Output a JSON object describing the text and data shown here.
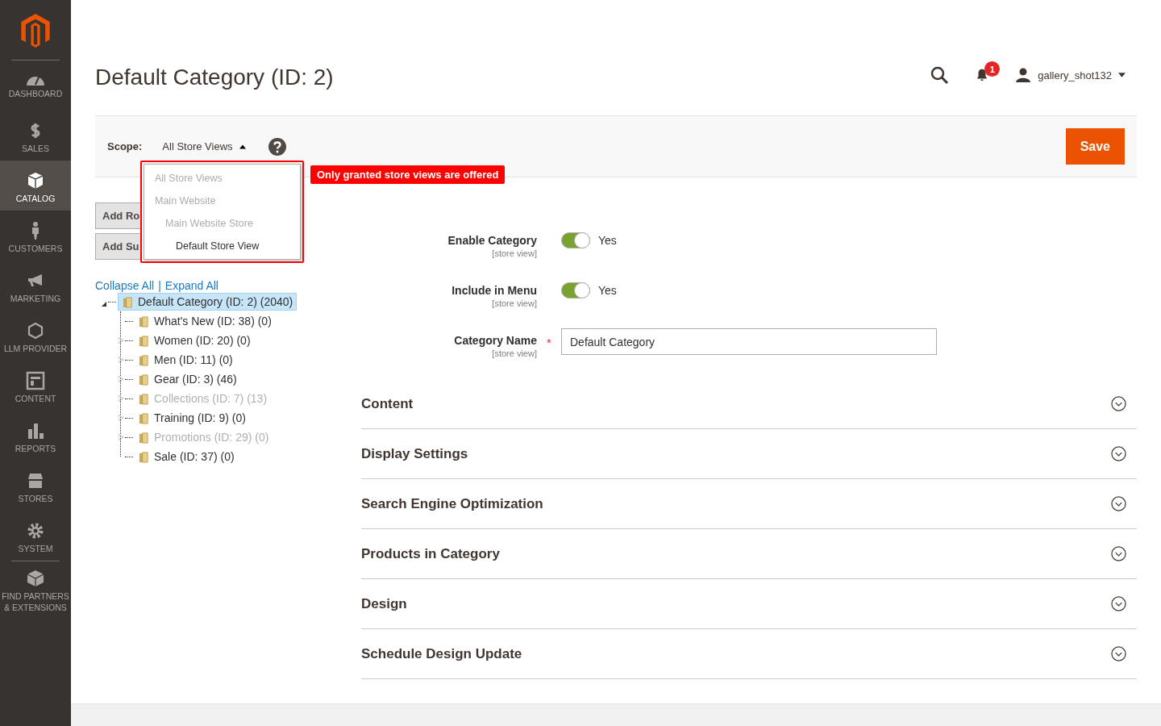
{
  "sidebar": {
    "items": [
      {
        "label": "DASHBOARD",
        "selected": false
      },
      {
        "label": "SALES",
        "selected": false
      },
      {
        "label": "CATALOG",
        "selected": true
      },
      {
        "label": "CUSTOMERS",
        "selected": false
      },
      {
        "label": "MARKETING",
        "selected": false
      },
      {
        "label": "LLM PROVIDER",
        "selected": false
      },
      {
        "label": "CONTENT",
        "selected": false
      },
      {
        "label": "REPORTS",
        "selected": false
      },
      {
        "label": "STORES",
        "selected": false
      },
      {
        "label": "SYSTEM",
        "selected": false
      },
      {
        "label": "FIND PARTNERS & EXTENSIONS",
        "selected": false
      }
    ]
  },
  "page_title": "Default Category (ID: 2)",
  "header": {
    "notification_count": "1",
    "user": "gallery_shot132"
  },
  "scope": {
    "label": "Scope:",
    "value": "All Store Views",
    "expanded": true,
    "options": [
      {
        "label": "All Store Views",
        "disabled": true
      },
      {
        "label": "Main Website",
        "disabled": true,
        "children": [
          {
            "label": "Main Website Store",
            "disabled": true,
            "children": [
              {
                "label": "Default Store View",
                "disabled": false
              }
            ]
          }
        ]
      }
    ],
    "notice": "Only granted store views are offered"
  },
  "save_button": "Save",
  "buttons": [
    "Add Ro",
    "Add Su"
  ],
  "tree_links": [
    "Collapse All",
    "|",
    "Expand All"
  ],
  "tree": {
    "label": "Default Category (ID: 2) (2040)",
    "selected": true,
    "disabled": false,
    "collapsed": false,
    "children": [
      {
        "label": "What's New (ID: 38) (0)",
        "selected": false,
        "disabled": false,
        "collapsed": false
      },
      {
        "label": "Women (ID: 20) (0)",
        "selected": false,
        "disabled": false,
        "collapsed": true
      },
      {
        "label": "Men (ID: 11) (0)",
        "selected": false,
        "disabled": false,
        "collapsed": true
      },
      {
        "label": "Gear (ID: 3) (46)",
        "selected": false,
        "disabled": false,
        "collapsed": true
      },
      {
        "label": "Collections (ID: 7) (13)",
        "selected": false,
        "disabled": true,
        "collapsed": true
      },
      {
        "label": "Training (ID: 9) (0)",
        "selected": false,
        "disabled": false,
        "collapsed": true
      },
      {
        "label": "Promotions (ID: 29) (0)",
        "selected": false,
        "disabled": true,
        "collapsed": true
      },
      {
        "label": "Sale (ID: 37) (0)",
        "selected": false,
        "disabled": false,
        "collapsed": false
      }
    ]
  },
  "fields": [
    {
      "kind": "toggle",
      "label": "Enable Category",
      "scope": "[store view]",
      "on": true,
      "value": "Yes"
    },
    {
      "kind": "toggle",
      "label": "Include in Menu",
      "scope": "[store view]",
      "on": true,
      "value": "Yes"
    },
    {
      "kind": "text",
      "label": "Category Name",
      "scope": "[store view]",
      "value": "Default Category",
      "required_mark": "*"
    }
  ],
  "sections": [
    "Content",
    "Display Settings",
    "Search Engine Optimization",
    "Products in Category",
    "Design",
    "Schedule Design Update"
  ]
}
